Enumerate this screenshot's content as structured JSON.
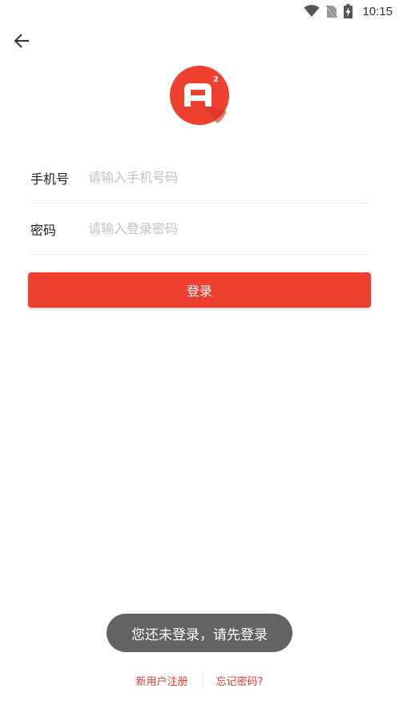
{
  "status_bar": {
    "time": "10:15",
    "icons": [
      "wifi-icon",
      "no-sim-icon",
      "battery-charging-icon"
    ]
  },
  "header": {
    "back_icon": "arrow-left-icon"
  },
  "logo": {
    "letter": "A",
    "superscript": "2",
    "color": "#ee4130"
  },
  "form": {
    "phone": {
      "label": "手机号",
      "value": "",
      "placeholder": "请输入手机号码"
    },
    "password": {
      "label": "密码",
      "value": "",
      "placeholder": "请输入登录密码"
    }
  },
  "login_button": {
    "label": "登录",
    "color": "#ee4130"
  },
  "toast": {
    "message": "您还未登录，请先登录"
  },
  "footer": {
    "register_label": "新用户注册",
    "forgot_label": "忘记密码?",
    "link_color": "#e23a2b"
  }
}
